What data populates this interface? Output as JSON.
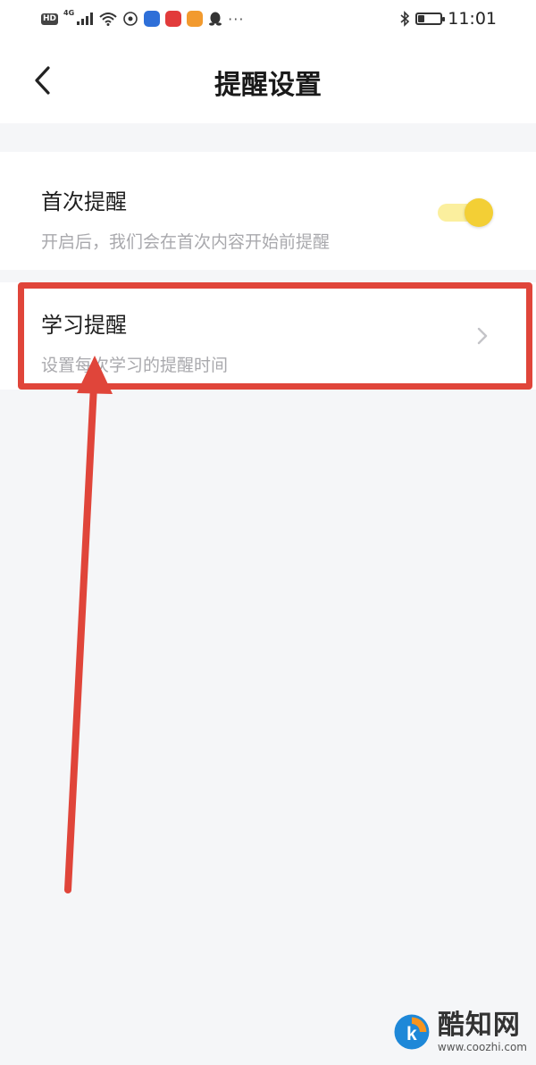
{
  "status_bar": {
    "hd_label": "HD",
    "network_label": "4G",
    "more_label": "···",
    "time": "11:01",
    "battery_level": 0.3,
    "colors": {
      "app_blue": "#2e6fd8",
      "app_red": "#e23b3b",
      "app_orange": "#f29a2e"
    }
  },
  "header": {
    "title": "提醒设置",
    "back_icon": "chevron-left-icon"
  },
  "settings": {
    "first_reminder": {
      "title": "首次提醒",
      "subtitle": "开启后，我们会在首次内容开始前提醒",
      "enabled": true
    },
    "study_reminder": {
      "title": "学习提醒",
      "subtitle": "设置每次学习的提醒时间",
      "icon": "chevron-right-icon"
    }
  },
  "theme": {
    "toggle_knob": "#f3cf35",
    "toggle_track": "#fbef9e",
    "annotation": "#e0453a",
    "background": "#f5f6f8"
  },
  "watermark": {
    "name": "酷知网",
    "url": "www.coozhi.com"
  }
}
